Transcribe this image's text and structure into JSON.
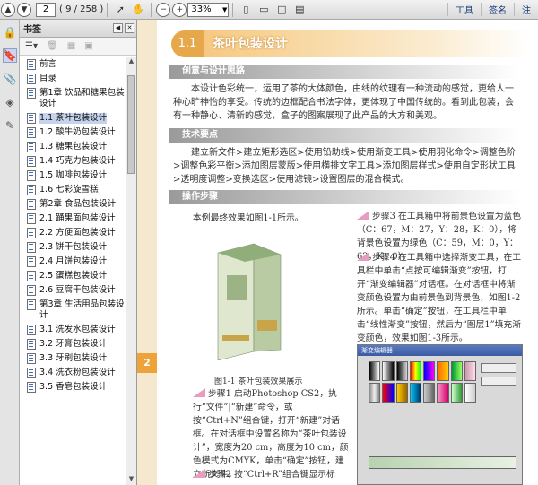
{
  "toolbar": {
    "page_current": "2",
    "page_count": "( 9 / 258 )",
    "zoom": "33%",
    "tools_label": "工具",
    "sign_label": "签名",
    "comment_label": "注"
  },
  "panel": {
    "title": "书签",
    "items": [
      {
        "label": "前言"
      },
      {
        "label": "目录"
      },
      {
        "label": "第1章 饮品和糖果包装设计"
      },
      {
        "label": "1.1 茶叶包装设计",
        "selected": true
      },
      {
        "label": "1.2 酸牛奶包装设计"
      },
      {
        "label": "1.3 糖果包装设计"
      },
      {
        "label": "1.4 巧克力包装设计"
      },
      {
        "label": "1.5 咖啡包装设计"
      },
      {
        "label": "1.6 七彩旋雪糕"
      },
      {
        "label": "第2章 食品包装设计"
      },
      {
        "label": "2.1 踊果面包装设计"
      },
      {
        "label": "2.2 方便面包装设计"
      },
      {
        "label": "2.3 饼干包装设计"
      },
      {
        "label": "2.4 月饼包装设计"
      },
      {
        "label": "2.5 蛋糕包装设计"
      },
      {
        "label": "2.6 豆腐干包装设计"
      },
      {
        "label": "第3章 生活用品包装设计"
      },
      {
        "label": "3.1 洗发水包装设计"
      },
      {
        "label": "3.2 牙膏包装设计"
      },
      {
        "label": "3.3 牙刷包装设计"
      },
      {
        "label": "3.4 洗衣粉包装设计"
      },
      {
        "label": "3.5 香皂包装设计"
      }
    ]
  },
  "document": {
    "page_tab": "2",
    "chapter_num": "1.1",
    "chapter_title": "茶叶包装设计",
    "sec1": "创意与设计思路",
    "para1": "本设计色彩统一，运用了茶的大体颜色，由线的纹理有一种流动的感觉，更给人一种心旷神怡的享受。传统的边框配合书法字体，更体现了中国传统的。看到此包装，会有一种静心、清新的感觉，盒子的图案展现了此产品的大方和美观。",
    "sec2": "技术要点",
    "para2": "建立新文件>建立矩形选区>使用铅助线>使用渐变工具>使用羽化命令>调整色阶>调整色彩平衡>添加图层蒙版>使用横排文字工具>添加图层样式>使用自定形状工具>透明度调整>变换选区>使用滤镜>设置图层的混合模式。",
    "sec3": "操作步骤",
    "intro": "本例最终效果如图1-1所示。",
    "step3": "步骤3 在工具箱中将前景色设置为蓝色（C：67，M：27，Y：28，K：0），将背景色设置为绿色（C：59，M：0，Y：62，K：0）。",
    "step4": "步骤4 在工具箱中选择渐变工具，在工具栏中单击“点按可编辑渐变”按钮，打开“渐变编辑器”对话框。在对话框中将渐变颜色设置为由前景色到背景色，如图1-2所示。单击“确定”按钮，在工具栏中单击“线性渐变”按钮，然后为“图层1”填充渐变颜色，效果如图1-3所示。",
    "caption": "图1-1 茶叶包装效果展示",
    "step1": "步骤1 启动Photoshop CS2，执行“文件”|“新建”命令，或按“Ctrl+N”组合键，打开“新建”对话框。在对话框中设置名称为“茶叶包装设计”，宽度为20 cm，高度为10 cm，颜色模式为CMYK，单击“确定”按钮，建立新文件。",
    "step2": "步骤2 按“Ctrl+R”组合键显示标",
    "dialog_title": "渐变编辑器"
  },
  "colors": {
    "accent_orange": "#e7a84c",
    "selection": "#c5d4ec"
  }
}
